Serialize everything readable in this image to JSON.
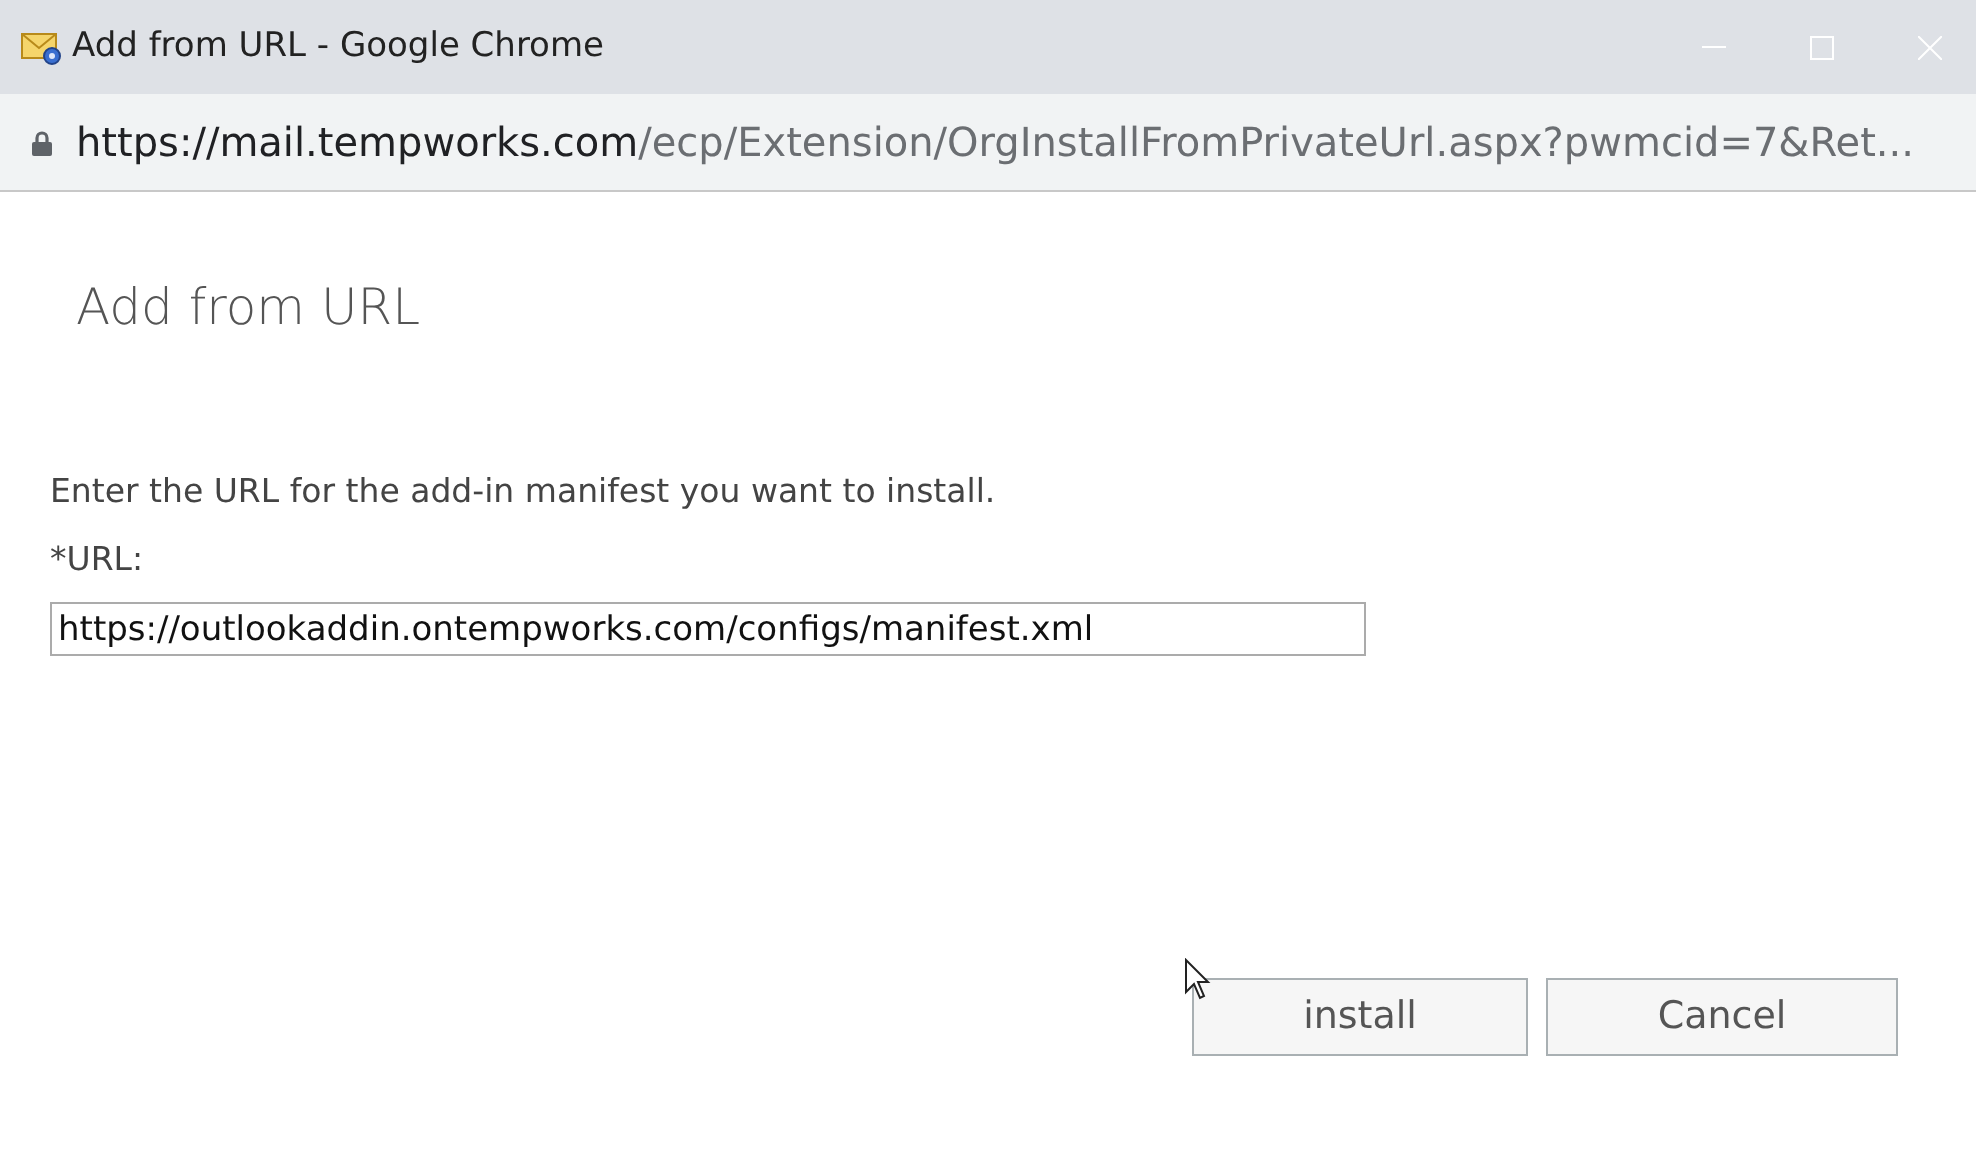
{
  "window": {
    "title": "Add from URL - Google Chrome"
  },
  "address_bar": {
    "host": "https://mail.tempworks.com",
    "path": "/ecp/Extension/OrgInstallFromPrivateUrl.aspx?pwmcid=7&Ret..."
  },
  "dialog": {
    "heading": "Add from URL",
    "instruction": "Enter the URL for the add-in manifest you want to install.",
    "field_label": "*URL:",
    "field_value": "https://outlookaddin.ontempworks.com/configs/manifest.xml"
  },
  "buttons": [
    {
      "label": "install"
    },
    {
      "label": "Cancel"
    }
  ]
}
